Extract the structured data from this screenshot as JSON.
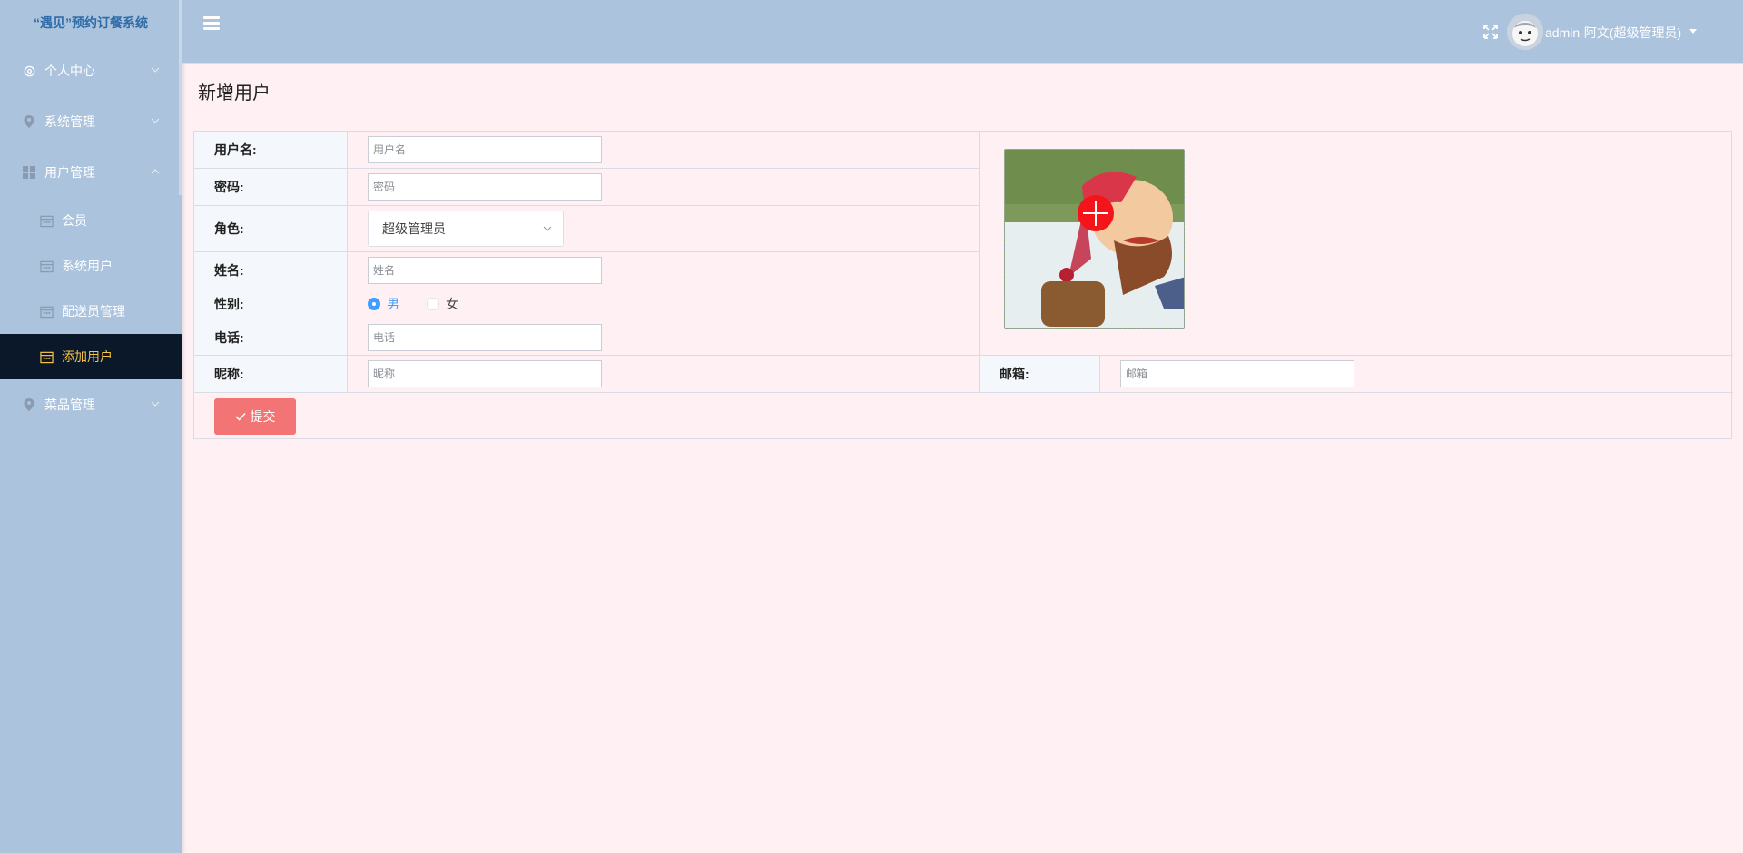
{
  "sidebar": {
    "brand": "“遇见”预约订餐系统",
    "items": [
      {
        "label": "个人中心",
        "icon": "gear-icon"
      },
      {
        "label": "系统管理",
        "icon": "location-icon"
      },
      {
        "label": "用户管理",
        "icon": "grid-icon"
      },
      {
        "label": "菜品管理",
        "icon": "location-icon"
      }
    ],
    "sub_items": [
      {
        "label": "会员",
        "icon": "calendar-icon"
      },
      {
        "label": "系统用户",
        "icon": "calendar-icon"
      },
      {
        "label": "配送员管理",
        "icon": "calendar-icon"
      },
      {
        "label": "添加用户",
        "icon": "calendar-icon",
        "active": true
      }
    ]
  },
  "header": {
    "user_label": "admin-阿文(超级管理员)"
  },
  "page": {
    "title": "新增用户"
  },
  "form": {
    "username": {
      "label": "用户名:",
      "placeholder": "用户名",
      "value": ""
    },
    "password": {
      "label": "密码:",
      "placeholder": "密码",
      "value": ""
    },
    "role": {
      "label": "角色:",
      "selected": "超级管理员"
    },
    "name": {
      "label": "姓名:",
      "placeholder": "姓名",
      "value": ""
    },
    "gender": {
      "label": "性别:",
      "options": [
        "男",
        "女"
      ],
      "selected": "男"
    },
    "phone": {
      "label": "电话:",
      "placeholder": "电话",
      "value": ""
    },
    "nickname": {
      "label": "昵称:",
      "placeholder": "昵称",
      "value": ""
    },
    "email": {
      "label": "邮箱:",
      "placeholder": "邮箱",
      "value": ""
    },
    "submit_label": "提交"
  },
  "colors": {
    "sidebar_bg": "#abc3dc",
    "active_item_bg": "#0b1829",
    "active_item_text": "#f4c247",
    "page_bg": "#fef0f3",
    "submit_bg": "#f27474",
    "radio_accent": "#409eff",
    "upload_plus": "#f5141a"
  }
}
